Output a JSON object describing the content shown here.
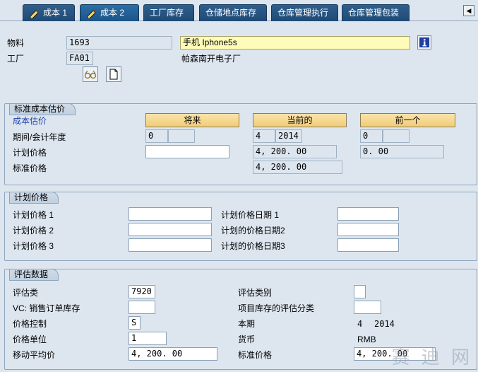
{
  "tabs": [
    {
      "label": "成本 1",
      "active": false
    },
    {
      "label": "成本 2",
      "active": true
    },
    {
      "label": "工厂库存",
      "active": false
    },
    {
      "label": "仓储地点库存",
      "active": false
    },
    {
      "label": "仓库管理执行",
      "active": false
    },
    {
      "label": "仓库管理包装",
      "active": false
    }
  ],
  "header": {
    "material_label": "物料",
    "material_value": "1693",
    "material_desc": "手机 Iphone5s",
    "plant_label": "工厂",
    "plant_value": "FA01",
    "plant_desc": "帕森南开电子厂"
  },
  "std_cost": {
    "title": "标准成本估价",
    "cost_estimate_label": "成本估价",
    "btn_future": "将来",
    "btn_current": "当前的",
    "btn_previous": "前一个",
    "period_label": "期间/会计年度",
    "future_period": "0",
    "future_year": "",
    "current_period": "4",
    "current_year": "2014",
    "previous_period": "0",
    "previous_year": "",
    "planned_price_label": "计划价格",
    "future_planned_price": "",
    "current_planned_price": "4, 200. 00",
    "previous_planned_price": "0. 00",
    "standard_price_label": "标准价格",
    "current_standard_price": "4, 200. 00"
  },
  "planned": {
    "title": "计划价格",
    "price1_label": "计划价格 1",
    "price2_label": "计划价格 2",
    "price3_label": "计划价格 3",
    "date1_label": "计划价格日期 1",
    "date2_label": "计划的价格日期2",
    "date3_label": "计划的价格日期3",
    "price1": "",
    "price2": "",
    "price3": "",
    "date1": "",
    "date2": "",
    "date3": ""
  },
  "valuation": {
    "title": "评估数据",
    "val_class_label": "评估类",
    "val_class": "7920",
    "vc_label": "VC: 销售订单库存",
    "vc_value": "",
    "price_control_label": "价格控制",
    "price_control": "S",
    "price_unit_label": "价格单位",
    "price_unit": "1",
    "map_label": "移动平均价",
    "map_value": "4, 200. 00",
    "val_category_label": "评估类别",
    "val_category": "",
    "proj_stock_label": "项目库存的评估分类",
    "proj_stock": "",
    "current_period_label": "本期",
    "current_period": "4",
    "current_year": "2014",
    "currency_label": "货币",
    "currency": "RMB",
    "std_price_label": "标准价格",
    "std_price": "4, 200. 00"
  },
  "watermark": "赛 迪 网"
}
